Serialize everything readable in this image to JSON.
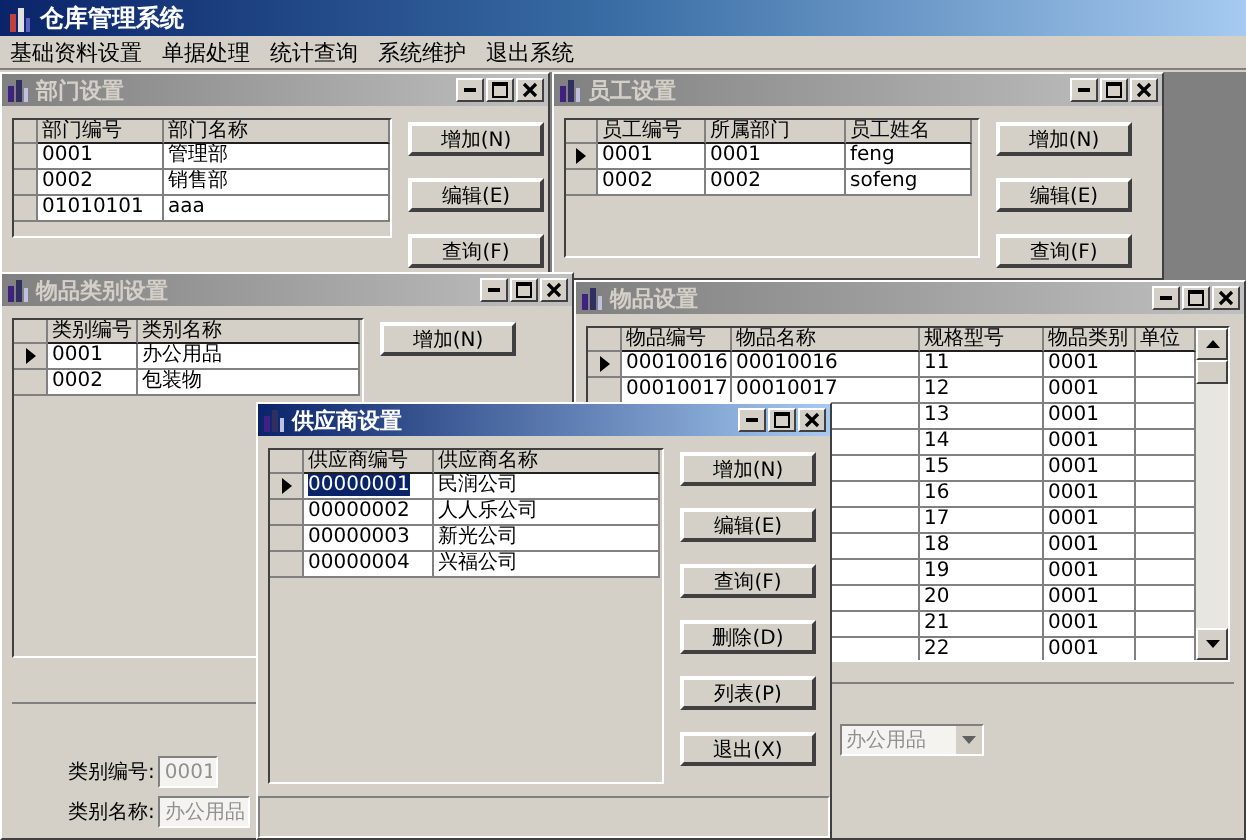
{
  "app": {
    "title": "仓库管理系统"
  },
  "menu": [
    "基础资料设置",
    "单据处理",
    "统计查询",
    "系统维护",
    "退出系统"
  ],
  "windows": [
    {
      "kind": "department",
      "title": "部门设置",
      "active": false,
      "grid": {
        "columns": [
          "部门编号",
          "部门名称"
        ],
        "rows": [
          {
            "selected": false,
            "cells": [
              "0001",
              "管理部"
            ]
          },
          {
            "selected": false,
            "cells": [
              "0002",
              "销售部"
            ]
          },
          {
            "selected": false,
            "cells": [
              "01010101",
              "aaa"
            ]
          }
        ]
      },
      "buttons": [
        "增加(N)",
        "编辑(E)",
        "查询(F)"
      ]
    },
    {
      "kind": "employee",
      "title": "员工设置",
      "active": false,
      "grid": {
        "columns": [
          "员工编号",
          "所属部门",
          "员工姓名"
        ],
        "rows": [
          {
            "selected": true,
            "cells": [
              "0001",
              "0001",
              "feng"
            ]
          },
          {
            "selected": false,
            "cells": [
              "0002",
              "0002",
              "sofeng"
            ]
          }
        ]
      },
      "buttons": [
        "增加(N)",
        "编辑(E)",
        "查询(F)"
      ]
    },
    {
      "kind": "category",
      "title": "物品类别设置",
      "active": false,
      "grid": {
        "columns": [
          "类别编号",
          "类别名称"
        ],
        "rows": [
          {
            "selected": true,
            "cells": [
              "0001",
              "办公用品"
            ]
          },
          {
            "selected": false,
            "cells": [
              "0002",
              "包装物"
            ]
          }
        ]
      },
      "buttons": [
        "增加(N)"
      ],
      "fields": [
        {
          "label": "类别编号:",
          "value": "0001",
          "disabled": true
        },
        {
          "label": "类别名称:",
          "value": "办公用品",
          "disabled": true
        }
      ]
    },
    {
      "kind": "goods",
      "title": "物品设置",
      "active": false,
      "grid": {
        "columns": [
          "物品编号",
          "物品名称",
          "规格型号",
          "物品类别",
          "单位"
        ],
        "rows": [
          {
            "selected": true,
            "cells": [
              "00010016",
              "00010016",
              "11",
              "0001"
            ]
          },
          {
            "selected": false,
            "cells": [
              "00010017",
              "00010017",
              "12",
              "0001"
            ]
          },
          {
            "cells": [
              null,
              null,
              "13",
              "0001"
            ]
          },
          {
            "cells": [
              null,
              null,
              "14",
              "0001"
            ]
          },
          {
            "cells": [
              null,
              null,
              "15",
              "0001"
            ]
          },
          {
            "cells": [
              null,
              null,
              "16",
              "0001"
            ]
          },
          {
            "cells": [
              null,
              null,
              "17",
              "0001"
            ]
          },
          {
            "cells": [
              null,
              null,
              "18",
              "0001"
            ]
          },
          {
            "cells": [
              null,
              null,
              "19",
              "0001"
            ]
          },
          {
            "cells": [
              null,
              null,
              "20",
              "0001"
            ]
          },
          {
            "cells": [
              null,
              null,
              "21",
              "0001"
            ]
          },
          {
            "cells": [
              null,
              null,
              "22",
              "0001"
            ]
          }
        ]
      },
      "combo": {
        "value": "办公用品"
      }
    },
    {
      "kind": "supplier",
      "title": "供应商设置",
      "active": true,
      "grid": {
        "columns": [
          "供应商编号",
          "供应商名称"
        ],
        "rows": [
          {
            "selected": true,
            "cells": [
              "00000001",
              "民润公司"
            ]
          },
          {
            "selected": false,
            "cells": [
              "00000002",
              "人人乐公司"
            ]
          },
          {
            "selected": false,
            "cells": [
              "00000003",
              "新光公司"
            ]
          },
          {
            "selected": false,
            "cells": [
              "00000004",
              "兴福公司"
            ]
          }
        ]
      },
      "buttons": [
        "增加(N)",
        "编辑(E)",
        "查询(F)",
        "删除(D)",
        "列表(P)",
        "退出(X)"
      ]
    }
  ]
}
